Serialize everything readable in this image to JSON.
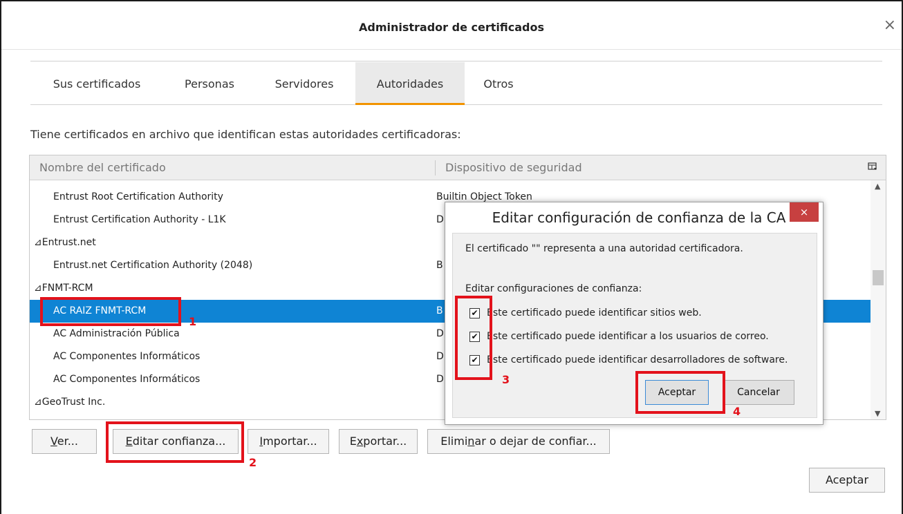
{
  "window": {
    "title": "Administrador de certificados",
    "close_glyph": "×"
  },
  "tabs": [
    {
      "label": "Sus certificados",
      "active": false
    },
    {
      "label": "Personas",
      "active": false
    },
    {
      "label": "Servidores",
      "active": false
    },
    {
      "label": "Autoridades",
      "active": true
    },
    {
      "label": "Otros",
      "active": false
    }
  ],
  "accent_color": "#f29300",
  "selection_color": "#0f84d4",
  "highlight_color": "#e3121b",
  "intro_text": "Tiene certificados en archivo que identifican estas autoridades certificadoras:",
  "table": {
    "col1_header": "Nombre del certificado",
    "col2_header": "Dispositivo de seguridad",
    "picker_icon": "column-picker-icon",
    "rows": [
      {
        "name": "Entrust Root Certification Authority",
        "device": "Builtin Object Token",
        "group": false,
        "selected": false
      },
      {
        "name": "Entrust Certification Authority - L1K",
        "device": "D",
        "group": false,
        "selected": false
      },
      {
        "name": "⊿Entrust.net",
        "device": "",
        "group": true,
        "selected": false
      },
      {
        "name": "Entrust.net Certification Authority (2048)",
        "device": "B",
        "group": false,
        "selected": false
      },
      {
        "name": "⊿FNMT-RCM",
        "device": "",
        "group": true,
        "selected": false
      },
      {
        "name": "AC RAIZ FNMT-RCM",
        "device": "B",
        "group": false,
        "selected": true
      },
      {
        "name": "AC Administración Pública",
        "device": "D",
        "group": false,
        "selected": false
      },
      {
        "name": "AC Componentes Informáticos",
        "device": "D",
        "group": false,
        "selected": false
      },
      {
        "name": "AC Componentes Informáticos",
        "device": "D",
        "group": false,
        "selected": false
      },
      {
        "name": "⊿GeoTrust Inc.",
        "device": "",
        "group": true,
        "selected": false
      }
    ]
  },
  "buttons": {
    "ver_a": "V",
    "ver_b": "er...",
    "editar_a": "E",
    "editar_b": "ditar confianza...",
    "importar_a": "I",
    "importar_b": "mportar...",
    "exportar_a": "E",
    "exportar_b": "x",
    "exportar_c": "portar...",
    "eliminar_a": "Elimi",
    "eliminar_b": "n",
    "eliminar_c": "ar o dejar de confiar...",
    "aceptar": "Aceptar"
  },
  "annotations": {
    "n1": "1",
    "n2": "2",
    "n3": "3",
    "n4": "4"
  },
  "modal": {
    "title": "Editar configuración de confianza de la CA",
    "close_glyph": "×",
    "message": "El certificado \"\" representa a una autoridad certificadora.",
    "label": "Editar configuraciones de confianza:",
    "checkboxes": [
      {
        "text": "Este certificado puede identificar sitios web.",
        "checked": true
      },
      {
        "text": "Este certificado puede identificar a los usuarios de correo.",
        "checked": true
      },
      {
        "text": "Este certificado puede identificar desarrolladores de software.",
        "checked": true
      }
    ],
    "check_glyph": "✔",
    "ok_label": "Aceptar",
    "cancel_label": "Cancelar"
  }
}
